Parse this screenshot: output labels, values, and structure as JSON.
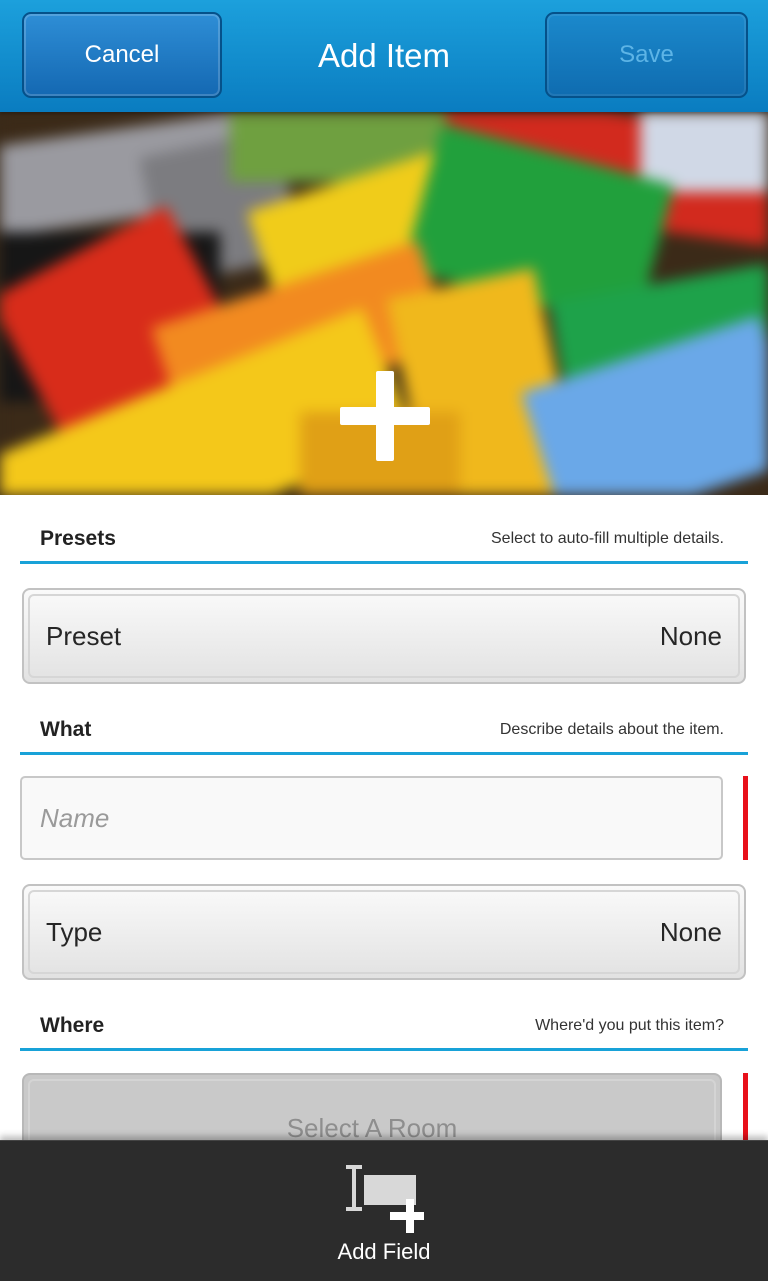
{
  "titlebar": {
    "cancel_label": "Cancel",
    "title": "Add Item",
    "save_label": "Save"
  },
  "photo": {
    "add_icon": "plus-icon"
  },
  "sections": {
    "presets": {
      "title": "Presets",
      "hint": "Select to auto-fill multiple details."
    },
    "what": {
      "title": "What",
      "hint": "Describe details about the item."
    },
    "where": {
      "title": "Where",
      "hint": "Where'd you put this item?"
    }
  },
  "preset_dropdown": {
    "label": "Preset",
    "value": "None"
  },
  "name_field": {
    "placeholder": "Name",
    "value": ""
  },
  "type_dropdown": {
    "label": "Type",
    "value": "None"
  },
  "room_button": {
    "label": "Select A Room"
  },
  "actionbar": {
    "add_field_label": "Add Field",
    "add_field_icon": "add-field-icon"
  },
  "colors": {
    "accent": "#18a2d8",
    "titlebar": "#0a7cc0",
    "required_marker": "#e8101a",
    "actionbar_bg": "#2c2c2c"
  }
}
